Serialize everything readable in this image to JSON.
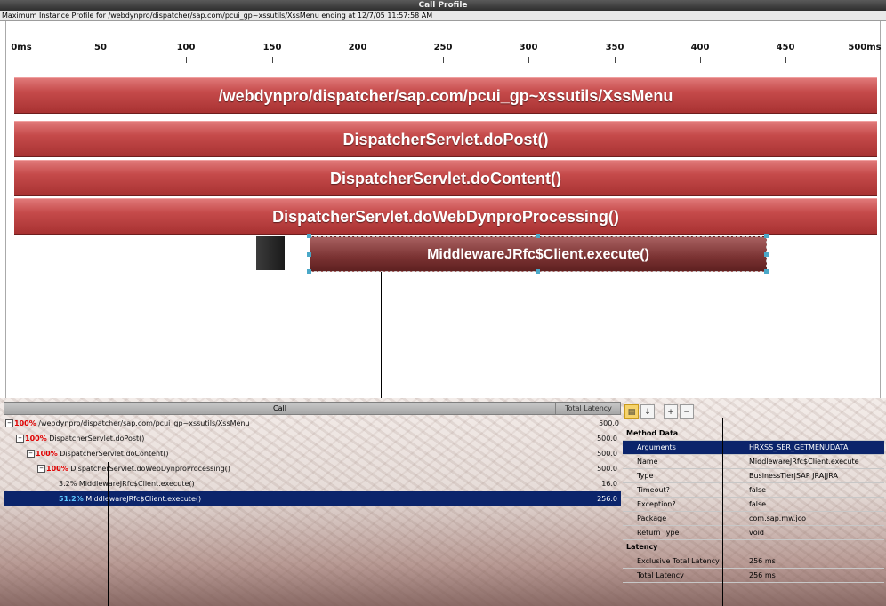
{
  "window": {
    "title": "Call Profile",
    "subtitle": "Maximum Instance Profile for /webdynpro/dispatcher/sap.com/pcui_gp~xssutils/XssMenu ending at 12/7/05 11:57:58 AM"
  },
  "ruler": {
    "ticks": [
      "0ms",
      "50",
      "100",
      "150",
      "200",
      "250",
      "300",
      "350",
      "400",
      "450",
      "500ms"
    ]
  },
  "bars": [
    "/webdynpro/dispatcher/sap.com/pcui_gp~xssutils/XssMenu",
    "DispatcherServlet.doPost()",
    "DispatcherServlet.doContent()",
    "DispatcherServlet.doWebDynproProcessing()"
  ],
  "selected_bar": "MiddlewareJRfc$Client.execute()",
  "call_tree": {
    "columns": {
      "call": "Call",
      "latency": "Total Latency"
    },
    "rows": [
      {
        "toggle": "−",
        "pct": "100%",
        "name": "/webdynpro/dispatcher/sap.com/pcui_gp~xssutils/XssMenu",
        "latency": "500.0"
      },
      {
        "toggle": "−",
        "pct": "100%",
        "name": "DispatcherServlet.doPost()",
        "latency": "500.0"
      },
      {
        "toggle": "−",
        "pct": "100%",
        "name": "DispatcherServlet.doContent()",
        "latency": "500.0"
      },
      {
        "toggle": "−",
        "pct": "100%",
        "name": "DispatcherServlet.doWebDynproProcessing()",
        "latency": "500.0"
      },
      {
        "toggle": "",
        "pct": "3.2%",
        "name": "MiddlewareJRfc$Client.execute()",
        "latency": "16.0"
      },
      {
        "toggle": "",
        "pct": "51.2%",
        "name": "MiddlewareJRfc$Client.execute()",
        "latency": "256.0"
      }
    ]
  },
  "properties": {
    "toolbar_icons": [
      "sort-category-icon",
      "sort-alpha-icon",
      "expand-all-icon",
      "collapse-all-icon"
    ],
    "groups": [
      {
        "name": "Method Data",
        "rows": [
          {
            "k": "Arguments",
            "v": "HRXSS_SER_GETMENUDATA"
          },
          {
            "k": "Name",
            "v": "MiddlewareJRfc$Client.execute"
          },
          {
            "k": "Type",
            "v": "BusinessTier|SAP JRA|JRA"
          },
          {
            "k": "Timeout?",
            "v": "false"
          },
          {
            "k": "Exception?",
            "v": "false"
          },
          {
            "k": "Package",
            "v": "com.sap.mw.jco"
          },
          {
            "k": "Return Type",
            "v": "void"
          }
        ]
      },
      {
        "name": "Latency",
        "rows": [
          {
            "k": "Exclusive Total Latency",
            "v": "256 ms"
          },
          {
            "k": "Total Latency",
            "v": "256 ms"
          }
        ]
      }
    ]
  }
}
